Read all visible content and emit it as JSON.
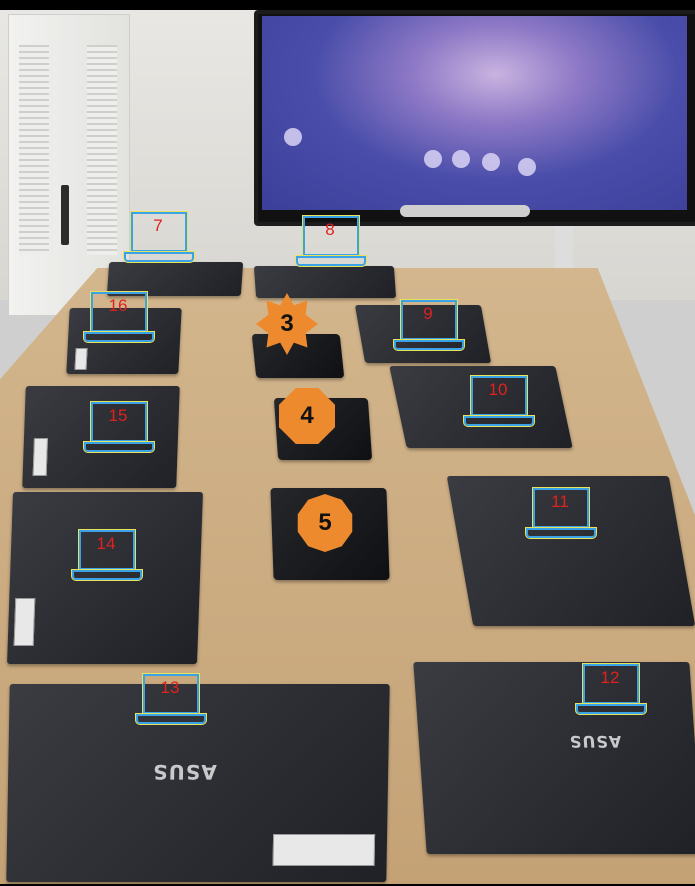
{
  "photo": {
    "laptop_labels": [
      "7",
      "8",
      "9",
      "10",
      "11",
      "12",
      "13",
      "14",
      "15",
      "16"
    ],
    "tablet_labels": [
      "3",
      "4",
      "5"
    ],
    "logo_text": "ASUS",
    "colors": {
      "marker_frame": "#3aa2e6",
      "marker_outline": "#e8e35a",
      "marker_number": "#e0221e",
      "badge_fill": "#ee8a2e"
    }
  }
}
